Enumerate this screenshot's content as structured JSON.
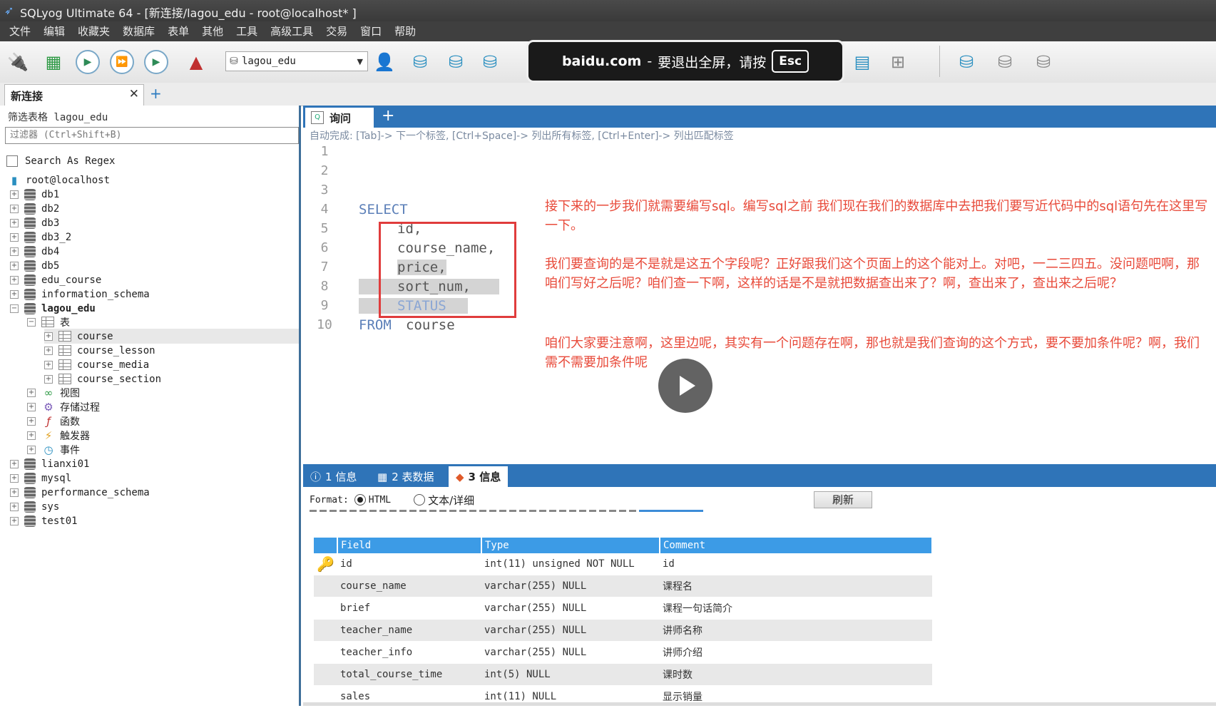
{
  "window": {
    "title": "SQLyog Ultimate 64 - [新连接/lagou_edu - root@localhost* ]"
  },
  "menu": [
    "文件",
    "编辑",
    "收藏夹",
    "数据库",
    "表单",
    "其他",
    "工具",
    "高级工具",
    "交易",
    "窗口",
    "帮助"
  ],
  "toolbar": {
    "database_selected": "lagou_edu"
  },
  "fullscreen_notice": {
    "domain": "baidu.com",
    "separator": "-",
    "message": "要退出全屏，请按",
    "key": "Esc"
  },
  "connection_tab": {
    "label": "新连接",
    "close": "✕",
    "add": "+"
  },
  "object_browser": {
    "filter_title": "筛选表格 lagou_edu",
    "filter_placeholder": "过滤器 (Ctrl+Shift+B)",
    "regex_label": "Search As Regex",
    "root": "root@localhost",
    "databases_top": [
      "db1",
      "db2",
      "db3",
      "db3_2",
      "db4",
      "db5",
      "edu_course",
      "information_schema"
    ],
    "active_db": "lagou_edu",
    "tables_folder": "表",
    "tables": [
      "course",
      "course_lesson",
      "course_media",
      "course_section"
    ],
    "folders": [
      "视图",
      "存储过程",
      "函数",
      "触发器",
      "事件"
    ],
    "databases_bottom": [
      "lianxi01",
      "mysql",
      "performance_schema",
      "sys",
      "test01"
    ]
  },
  "query_tab": {
    "label": "询问",
    "add": "+"
  },
  "autocomplete_hint": "自动完成:  [Tab]-> 下一个标签,  [Ctrl+Space]-> 列出所有标签,  [Ctrl+Enter]-> 列出匹配标签",
  "editor": {
    "line_numbers": [
      "1",
      "2",
      "3",
      "4",
      "5",
      "6",
      "7",
      "8",
      "9",
      "10"
    ],
    "select_kw": "SELECT",
    "col_id": "id,",
    "col_course_name": "course_name,",
    "col_price": "price,",
    "col_sort_num": "sort_num,",
    "col_status": "STATUS",
    "from_kw": "FROM",
    "table": "course"
  },
  "annotations": [
    "接下来的一步我们就需要编写sql。编写sql之前 我们现在我们的数据库中去把我们要写近代码中的sql语句先在这里写一下。",
    "我们要查询的是不是就是这五个字段呢？正好跟我们这个页面上的这个能对上。对吧，一二三四五。没问题吧啊，那咱们写好之后呢？咱们查一下啊，这样的话是不是就把数据查出来了？啊，查出来了，查出来之后呢？",
    "咱们大家要注意啊，这里边呢，其实有一个问题存在啊，那也就是我们查询的这个方式，要不要加条件呢？啊，我们需不需要加条件呢"
  ],
  "result_tabs": [
    {
      "label": "1 信息",
      "icon": "info-icon"
    },
    {
      "label": "2 表数据",
      "icon": "table-icon"
    },
    {
      "label": "3 信息",
      "icon": "info-color-icon"
    }
  ],
  "format_bar": {
    "label": "Format:",
    "opt_html": "HTML",
    "opt_text": "文本/详细",
    "refresh": "刷新"
  },
  "fields_table": {
    "headers": [
      "Field",
      "Type",
      "Comment"
    ],
    "rows": [
      {
        "field": "id",
        "type": "int(11) unsigned NOT NULL",
        "comment": "id",
        "primary_key": true
      },
      {
        "field": "course_name",
        "type": "varchar(255) NULL",
        "comment": "课程名"
      },
      {
        "field": "brief",
        "type": "varchar(255) NULL",
        "comment": "课程一句话简介"
      },
      {
        "field": "teacher_name",
        "type": "varchar(255) NULL",
        "comment": "讲师名称"
      },
      {
        "field": "teacher_info",
        "type": "varchar(255) NULL",
        "comment": "讲师介绍"
      },
      {
        "field": "total_course_time",
        "type": "int(5) NULL",
        "comment": "课时数"
      },
      {
        "field": "sales",
        "type": "int(11) NULL",
        "comment": "显示销量"
      }
    ]
  },
  "colors": {
    "accent": "#2f74b8",
    "annotation": "#e84a3a",
    "header_blue": "#3c9be6"
  }
}
